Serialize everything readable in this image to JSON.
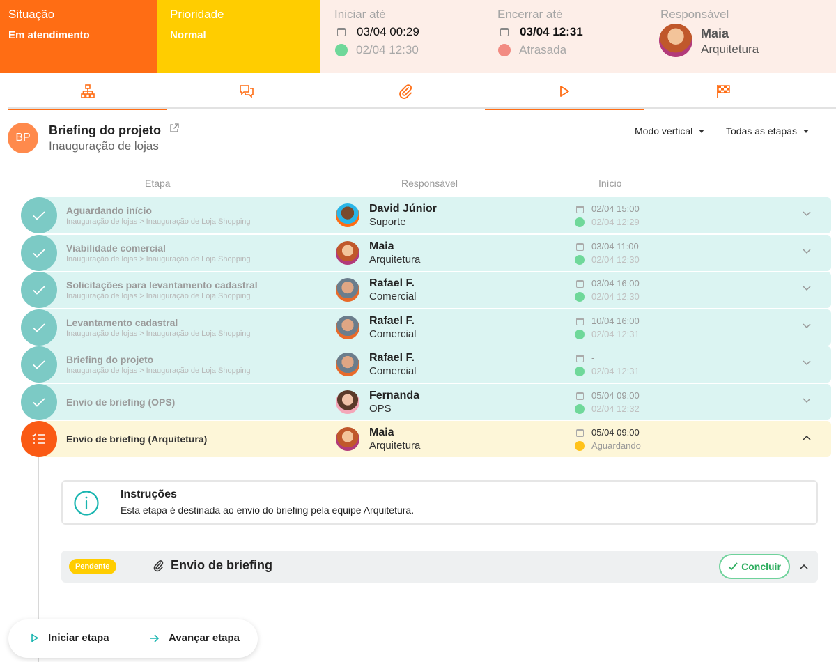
{
  "header": {
    "situacao": {
      "label": "Situação",
      "value": "Em atendimento"
    },
    "prioridade": {
      "label": "Prioridade",
      "value": "Normal"
    },
    "iniciar": {
      "label": "Iniciar até",
      "date": "03/04 00:29",
      "actual": "02/04 12:30"
    },
    "encerrar": {
      "label": "Encerrar até",
      "date": "03/04 12:31",
      "status": "Atrasada"
    },
    "responsavel": {
      "label": "Responsável",
      "name": "Maia",
      "dept": "Arquitetura"
    }
  },
  "tabs": [
    {
      "icon": "hierarchy-icon",
      "active": true
    },
    {
      "icon": "chat-icon",
      "active": false
    },
    {
      "icon": "paperclip-icon",
      "active": false
    },
    {
      "icon": "play-icon",
      "active": true
    },
    {
      "icon": "flag-icon",
      "active": false
    }
  ],
  "project": {
    "initials": "BP",
    "title": "Briefing do projeto",
    "subtitle": "Inauguração de lojas"
  },
  "filters": {
    "mode": "Modo vertical",
    "stages": "Todas as etapas"
  },
  "columns": {
    "etapa": "Etapa",
    "responsavel": "Responsável",
    "inicio": "Início"
  },
  "stages": [
    {
      "name": "Aguardando início",
      "path": "Inauguração de lojas > Inauguração de Loja Shopping",
      "person": "David Júnior",
      "dept": "Suporte",
      "planned": "02/04 15:00",
      "actual": "02/04 12:29",
      "state": "done"
    },
    {
      "name": "Viabilidade comercial",
      "path": "Inauguração de lojas > Inauguração de Loja Shopping",
      "person": "Maia",
      "dept": "Arquitetura",
      "planned": "03/04 11:00",
      "actual": "02/04 12:30",
      "state": "done"
    },
    {
      "name": "Solicitações para levantamento cadastral",
      "path": "Inauguração de lojas > Inauguração de Loja Shopping",
      "person": "Rafael F.",
      "dept": "Comercial",
      "planned": "03/04 16:00",
      "actual": "02/04 12:30",
      "state": "done"
    },
    {
      "name": "Levantamento cadastral",
      "path": "Inauguração de lojas > Inauguração de Loja Shopping",
      "person": "Rafael F.",
      "dept": "Comercial",
      "planned": "10/04 16:00",
      "actual": "02/04 12:31",
      "state": "done"
    },
    {
      "name": "Briefing do projeto",
      "path": "Inauguração de lojas > Inauguração de Loja Shopping",
      "person": "Rafael F.",
      "dept": "Comercial",
      "planned": "-",
      "actual": "02/04 12:31",
      "state": "done"
    },
    {
      "name": "Envio de briefing (OPS)",
      "path": "",
      "person": "Fernanda",
      "dept": "OPS",
      "planned": "05/04 09:00",
      "actual": "02/04 12:32",
      "state": "done"
    },
    {
      "name": "Envio de briefing (Arquitetura)",
      "path": "",
      "person": "Maia",
      "dept": "Arquitetura",
      "planned": "05/04 09:00",
      "actual": "Aguardando",
      "state": "current"
    }
  ],
  "instructions": {
    "title": "Instruções",
    "text": "Esta etapa é destinada ao envio do briefing pela equipe Arquitetura."
  },
  "task": {
    "badge": "Pendente",
    "name": "Envio de briefing",
    "action": "Concluir"
  },
  "actions": {
    "start": "Iniciar etapa",
    "advance": "Avançar etapa"
  },
  "colors": {
    "orange": "#ff6d14",
    "yellow": "#ffcd00",
    "teal": "#7ccac5",
    "green": "#6fd89a",
    "red": "#f28b82"
  }
}
